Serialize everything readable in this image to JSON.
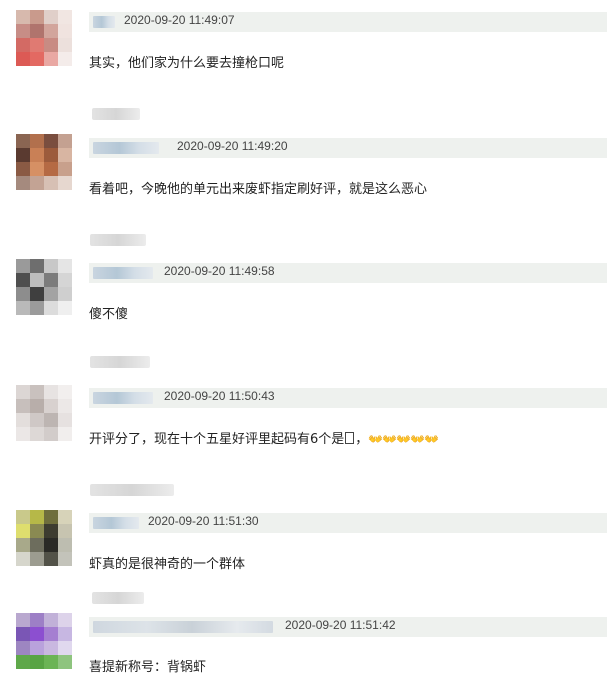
{
  "comments": [
    {
      "time": "2020-09-20 11:49:07",
      "text": "其实，他们家为什么要去撞枪口呢",
      "avatar_colors": [
        "#d7b9ad",
        "#c99a8c",
        "#e0cfc9",
        "#f1e6e2",
        "#c78d86",
        "#b0746d",
        "#d2a59c",
        "#f0e3df",
        "#d36a64",
        "#e07a72",
        "#c88b83",
        "#ece0dc",
        "#dc5a55",
        "#e36962",
        "#e9a8a3",
        "#f4ecea"
      ]
    },
    {
      "time": "2020-09-20 11:49:20",
      "text": "看着吧，今晚他的单元出来废虾指定刷好评，就是这么恶心",
      "avatar_colors": [
        "#8a6552",
        "#b2704d",
        "#7a4e3f",
        "#c4a191",
        "#5a3a30",
        "#c98056",
        "#9c5b3c",
        "#d8b5a2",
        "#8a5a44",
        "#d69064",
        "#b56a44",
        "#c8a08c",
        "#a58a7e",
        "#c3a394",
        "#d7c0b4",
        "#e6d7cf"
      ]
    },
    {
      "time": "2020-09-20 11:49:58",
      "text": "傻不傻",
      "avatar_colors": [
        "#9a9a9a",
        "#6e6e6e",
        "#c8c8c8",
        "#e5e5e5",
        "#4e4e4e",
        "#bdbdbd",
        "#7c7c7c",
        "#d5d5d5",
        "#8d8d8d",
        "#3f3f3f",
        "#a3a3a3",
        "#cfcfcf",
        "#b9b9b9",
        "#9b9b9b",
        "#dcdcdc",
        "#efefef"
      ]
    },
    {
      "time": "2020-09-20 11:50:43",
      "text": "开评分了，现在十个五星好评里起码有6个是",
      "text_suffix": "，",
      "avatar_colors": [
        "#dcd6d4",
        "#c9c1be",
        "#e7e3e2",
        "#f2efee",
        "#c7bfbc",
        "#b8aeaa",
        "#d8d1cf",
        "#ece8e7",
        "#e3dedc",
        "#cfc8c6",
        "#bdb5b2",
        "#e6e1e0",
        "#ebe7e6",
        "#ddd8d6",
        "#d2ccca",
        "#f1eeed"
      ]
    },
    {
      "time": "2020-09-20 11:51:30",
      "text": "虾真的是很神奇的一个群体",
      "avatar_colors": [
        "#c9c98b",
        "#b6b848",
        "#6f6e3c",
        "#d7d3b9",
        "#dede6e",
        "#8a8a52",
        "#3d3c30",
        "#c7c4b0",
        "#a8a98a",
        "#6d6d5d",
        "#2a2a26",
        "#bdbdb0",
        "#d6d6cc",
        "#9c9c90",
        "#525248",
        "#c3c3ba"
      ]
    },
    {
      "time": "2020-09-20 11:51:42",
      "text": "喜提新称号：背锅虾",
      "avatar_colors": [
        "#b9a8cf",
        "#9d7fc6",
        "#c1b1d8",
        "#ddd3ea",
        "#7a56b5",
        "#8c4fd0",
        "#a57fd1",
        "#c7b7e2",
        "#9d86c1",
        "#b9a2dc",
        "#c9b8e0",
        "#e0d8ee",
        "#5fa84a",
        "#58a444",
        "#6bb455",
        "#8ec47e"
      ]
    }
  ],
  "emoji": {
    "hands": "👐👐👐👐👐"
  }
}
